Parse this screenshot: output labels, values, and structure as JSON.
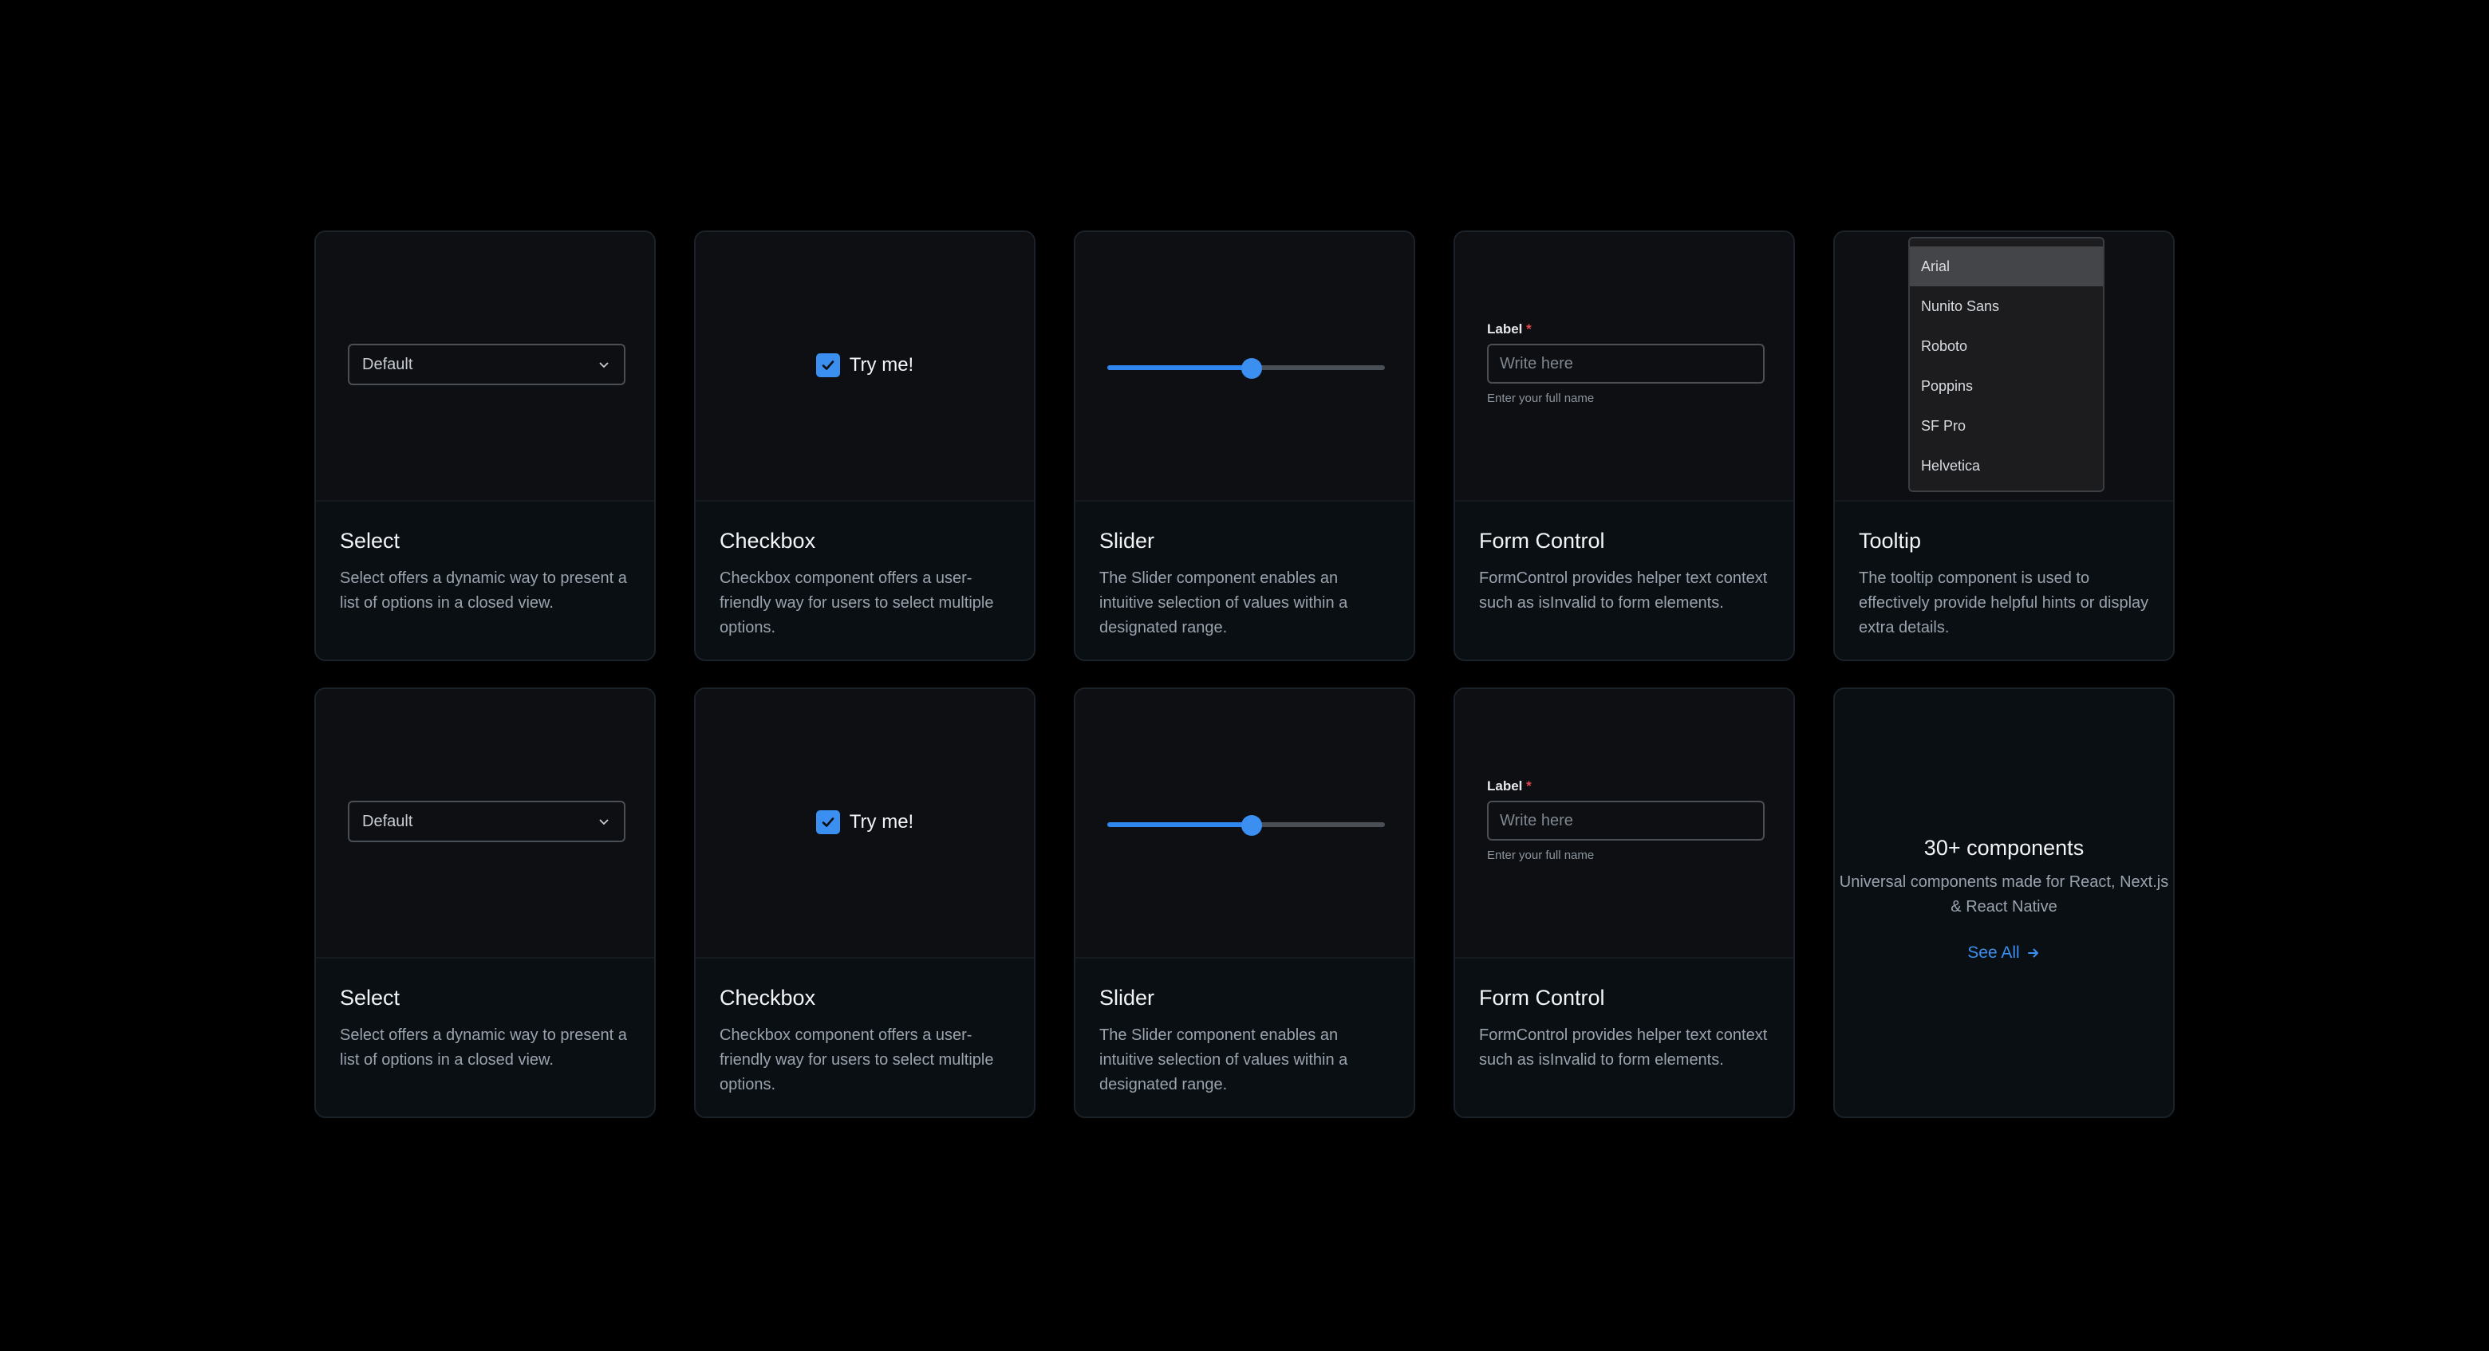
{
  "cards_row1": [
    {
      "title": "Select",
      "desc": "Select offers a dynamic way to present a list of options in a closed view.",
      "select_value": "Default"
    },
    {
      "title": "Checkbox",
      "desc": "Checkbox component offers a user-friendly way for users to select multiple options.",
      "checkbox_label": "Try me!"
    },
    {
      "title": "Slider",
      "desc": "The Slider component enables an intuitive selection of values within a designated range.",
      "slider_value": 0.52
    },
    {
      "title": "Form Control",
      "desc": "FormControl provides helper text context such as isInvalid to form elements.",
      "label": "Label",
      "required_mark": "*",
      "placeholder": "Write here",
      "helper": "Enter your full name"
    },
    {
      "title": "Tooltip",
      "desc": "The tooltip component is used to effectively provide helpful hints or display extra details.",
      "options": [
        "Arial",
        "Nunito Sans",
        "Roboto",
        "Poppins",
        "SF Pro",
        "Helvetica"
      ],
      "selected": "Arial"
    }
  ],
  "cards_row2": [
    {
      "title": "Select",
      "desc": "Select offers a dynamic way to present a list of options in a closed view.",
      "select_value": "Default"
    },
    {
      "title": "Checkbox",
      "desc": "Checkbox component offers a user-friendly way for users to select multiple options.",
      "checkbox_label": "Try me!"
    },
    {
      "title": "Slider",
      "desc": "The Slider component enables an intuitive selection of values within a designated range.",
      "slider_value": 0.52
    },
    {
      "title": "Form Control",
      "desc": "FormControl provides helper text context such as isInvalid to form elements.",
      "label": "Label",
      "required_mark": "*",
      "placeholder": "Write here",
      "helper": "Enter your full name"
    }
  ],
  "cta": {
    "title": "30+ components",
    "desc": "Universal components made for React, Next.js & React Native",
    "link": "See All"
  },
  "colors": {
    "accent": "#3b8ff0",
    "background": "#000000",
    "card": "#0a0f14",
    "required": "#e5484d"
  },
  "icons": {
    "select": "chevron-down-icon",
    "checkbox": "check-icon",
    "cta": "arrow-right-icon"
  }
}
